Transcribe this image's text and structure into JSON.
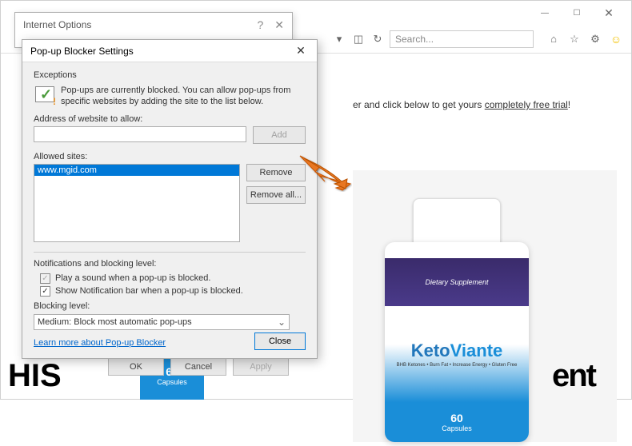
{
  "browser": {
    "search_placeholder": "Search...",
    "dropdown_icon": "▾",
    "refresh_icon": "↻",
    "stop_icon": "◫",
    "home_icon": "⌂",
    "star_icon": "☆",
    "gear_icon": "⚙",
    "smiley_icon": "☺",
    "minimize": "—",
    "maximize": "☐",
    "close": "✕"
  },
  "io_dialog": {
    "title": "Internet Options",
    "help": "?",
    "close": "✕",
    "ok": "OK",
    "cancel": "Cancel",
    "apply": "Apply"
  },
  "pb_dialog": {
    "title": "Pop-up Blocker Settings",
    "close": "✕",
    "exceptions_header": "Exceptions",
    "exceptions_text": "Pop-ups are currently blocked. You can allow pop-ups from specific websites by adding the site to the list below.",
    "address_label": "Address of website to allow:",
    "address_value": "",
    "add_btn": "Add",
    "allowed_label": "Allowed sites:",
    "allowed_items": [
      "www.mgid.com"
    ],
    "remove_btn": "Remove",
    "remove_all_btn": "Remove all...",
    "notif_header": "Notifications and blocking level:",
    "cb_sound": "Play a sound when a pop-up is blocked.",
    "cb_bar": "Show Notification bar when a pop-up is blocked.",
    "blocking_label": "Blocking level:",
    "blocking_value": "Medium: Block most automatic pop-ups",
    "learn_link": "Learn more about Pop-up Blocker",
    "close_btn": "Close"
  },
  "page": {
    "promo_pre": "er and click below to get yours ",
    "promo_link": "completely free trial",
    "promo_post": "!",
    "dietary": "Dietary Supplement",
    "brand_keto": "Keto",
    "brand_viante": "Viante",
    "subline": "BHB Ketones • Burn Fat • Increase Energy • Gluten Free",
    "caps_num": "60",
    "caps_txt": "Capsules",
    "headline_left": "HIS",
    "headline_right": "ent"
  }
}
